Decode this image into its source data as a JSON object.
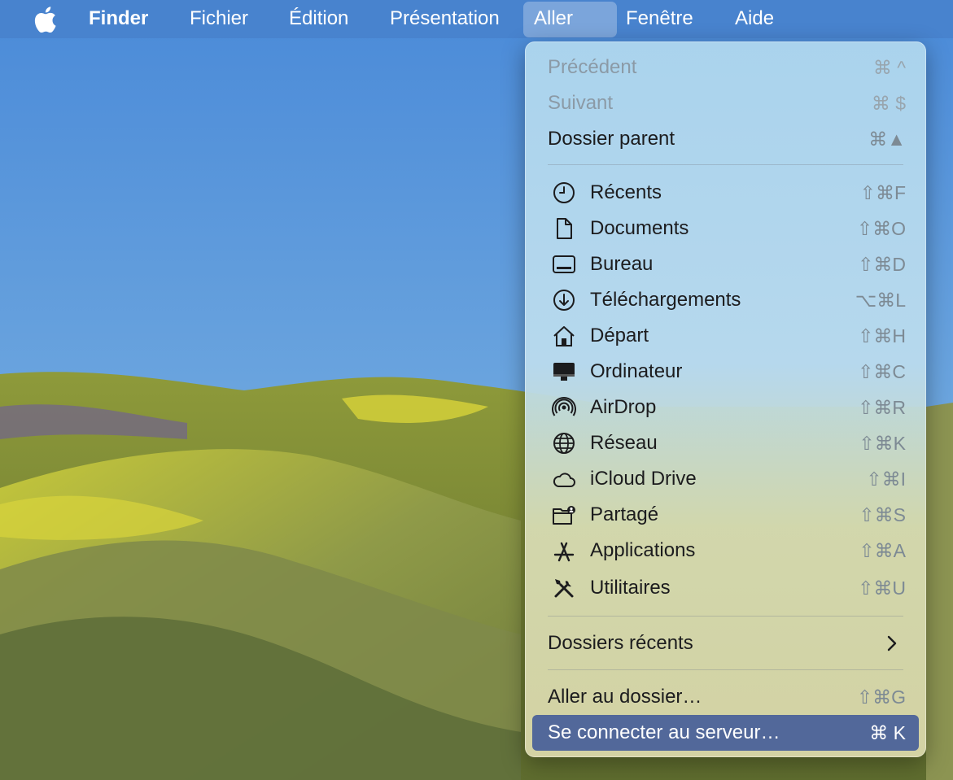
{
  "menubar": {
    "app_name": "Finder",
    "items": [
      "Fichier",
      "Édition",
      "Présentation",
      "Aller",
      "Fenêtre",
      "Aide"
    ],
    "active_item": "Aller"
  },
  "menu": {
    "nav": [
      {
        "label": "Précédent",
        "shortcut": "⌘ ^",
        "disabled": true
      },
      {
        "label": "Suivant",
        "shortcut": "⌘ $",
        "disabled": true
      },
      {
        "label": "Dossier parent",
        "shortcut": "⌘▲",
        "disabled": false
      }
    ],
    "places": [
      {
        "label": "Récents",
        "shortcut": "⇧⌘F",
        "icon": "clock-icon"
      },
      {
        "label": "Documents",
        "shortcut": "⇧⌘O",
        "icon": "document-icon"
      },
      {
        "label": "Bureau",
        "shortcut": "⇧⌘D",
        "icon": "desktop-icon"
      },
      {
        "label": "Téléchargements",
        "shortcut": "⌥⌘L",
        "icon": "download-icon"
      },
      {
        "label": "Départ",
        "shortcut": "⇧⌘H",
        "icon": "home-icon"
      },
      {
        "label": "Ordinateur",
        "shortcut": "⇧⌘C",
        "icon": "computer-icon"
      },
      {
        "label": "AirDrop",
        "shortcut": "⇧⌘R",
        "icon": "airdrop-icon"
      },
      {
        "label": "Réseau",
        "shortcut": "⇧⌘K",
        "icon": "globe-icon"
      },
      {
        "label": "iCloud Drive",
        "shortcut": "⇧⌘I",
        "icon": "cloud-icon"
      },
      {
        "label": "Partagé",
        "shortcut": "⇧⌘S",
        "icon": "shared-folder-icon"
      },
      {
        "label": "Applications",
        "shortcut": "⇧⌘A",
        "icon": "applications-icon"
      },
      {
        "label": "Utilitaires",
        "shortcut": "⇧⌘U",
        "icon": "utilities-icon"
      }
    ],
    "recent_folders": {
      "label": "Dossiers récents"
    },
    "go_to_folder": {
      "label": "Aller au dossier…",
      "shortcut": "⇧⌘G"
    },
    "connect_server": {
      "label": "Se connecter au serveur…",
      "shortcut": "⌘ K"
    }
  },
  "colors": {
    "selected": "#52689a",
    "menubar": "#4882cd"
  }
}
